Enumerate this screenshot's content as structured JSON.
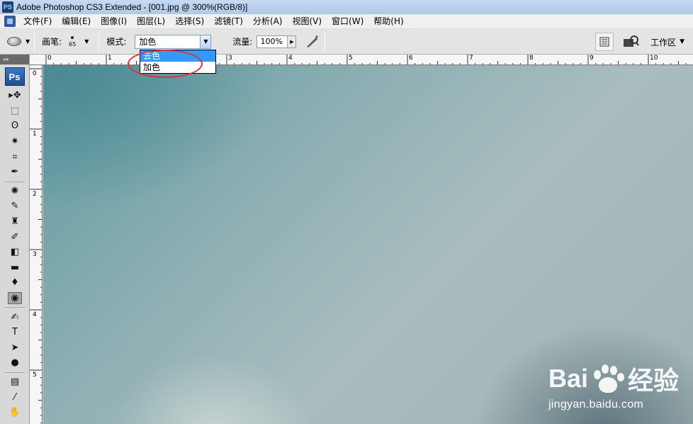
{
  "window": {
    "app_icon": "PS",
    "title": "Adobe Photoshop CS3 Extended - [001.jpg @ 300%(RGB/8)]"
  },
  "menubar": {
    "items": [
      "文件(F)",
      "编辑(E)",
      "图像(I)",
      "图层(L)",
      "选择(S)",
      "滤镜(T)",
      "分析(A)",
      "视图(V)",
      "窗口(W)",
      "帮助(H)"
    ]
  },
  "options": {
    "brush_label": "画笔:",
    "brush_size": "65",
    "mode_label": "模式:",
    "mode_value": "加色",
    "flow_label": "流量:",
    "flow_value": "100%",
    "workspace_label": "工作区"
  },
  "dropdown": {
    "options": [
      {
        "label": "去色",
        "selected": true
      },
      {
        "label": "加色",
        "selected": false
      }
    ]
  },
  "toolbox": {
    "badge": "Ps",
    "tools": [
      {
        "name": "move-tool-icon",
        "glyph": "▸✥"
      },
      {
        "name": "marquee-tool-icon",
        "glyph": "⬚"
      },
      {
        "name": "lasso-tool-icon",
        "glyph": "ʘ"
      },
      {
        "name": "magic-wand-tool-icon",
        "glyph": "✷"
      },
      {
        "name": "crop-tool-icon",
        "glyph": "⌗"
      },
      {
        "name": "eyedropper-tool-icon",
        "glyph": "✒"
      },
      {
        "name": "healing-brush-tool-icon",
        "glyph": "✺"
      },
      {
        "name": "brush-tool-icon",
        "glyph": "✎"
      },
      {
        "name": "clone-stamp-tool-icon",
        "glyph": "♜"
      },
      {
        "name": "history-brush-tool-icon",
        "glyph": "✐"
      },
      {
        "name": "eraser-tool-icon",
        "glyph": "◧"
      },
      {
        "name": "gradient-tool-icon",
        "glyph": "▬"
      },
      {
        "name": "blur-tool-icon",
        "glyph": "♦"
      },
      {
        "name": "sponge-tool-icon",
        "glyph": "◉"
      },
      {
        "name": "pen-tool-icon",
        "glyph": "✍"
      },
      {
        "name": "type-tool-icon",
        "glyph": "T"
      },
      {
        "name": "path-selection-tool-icon",
        "glyph": "➤"
      },
      {
        "name": "ellipse-tool-icon",
        "glyph": "●"
      },
      {
        "name": "notes-tool-icon",
        "glyph": "▤"
      },
      {
        "name": "eyedropper2-tool-icon",
        "glyph": "⁄"
      },
      {
        "name": "hand-tool-icon",
        "glyph": "✋"
      }
    ]
  },
  "rulers": {
    "horizontal": [
      "0",
      "1",
      "2",
      "3",
      "4",
      "5",
      "6",
      "7",
      "8",
      "9",
      "10"
    ],
    "vertical": [
      "0",
      "1",
      "2",
      "3",
      "4",
      "5"
    ]
  },
  "watermark": {
    "brand": "Bai",
    "brand_suffix": "经验",
    "url": "jingyan.baidu.com"
  },
  "colors": {
    "highlight": "#3399ff",
    "annotation_red": "#d9343a"
  }
}
